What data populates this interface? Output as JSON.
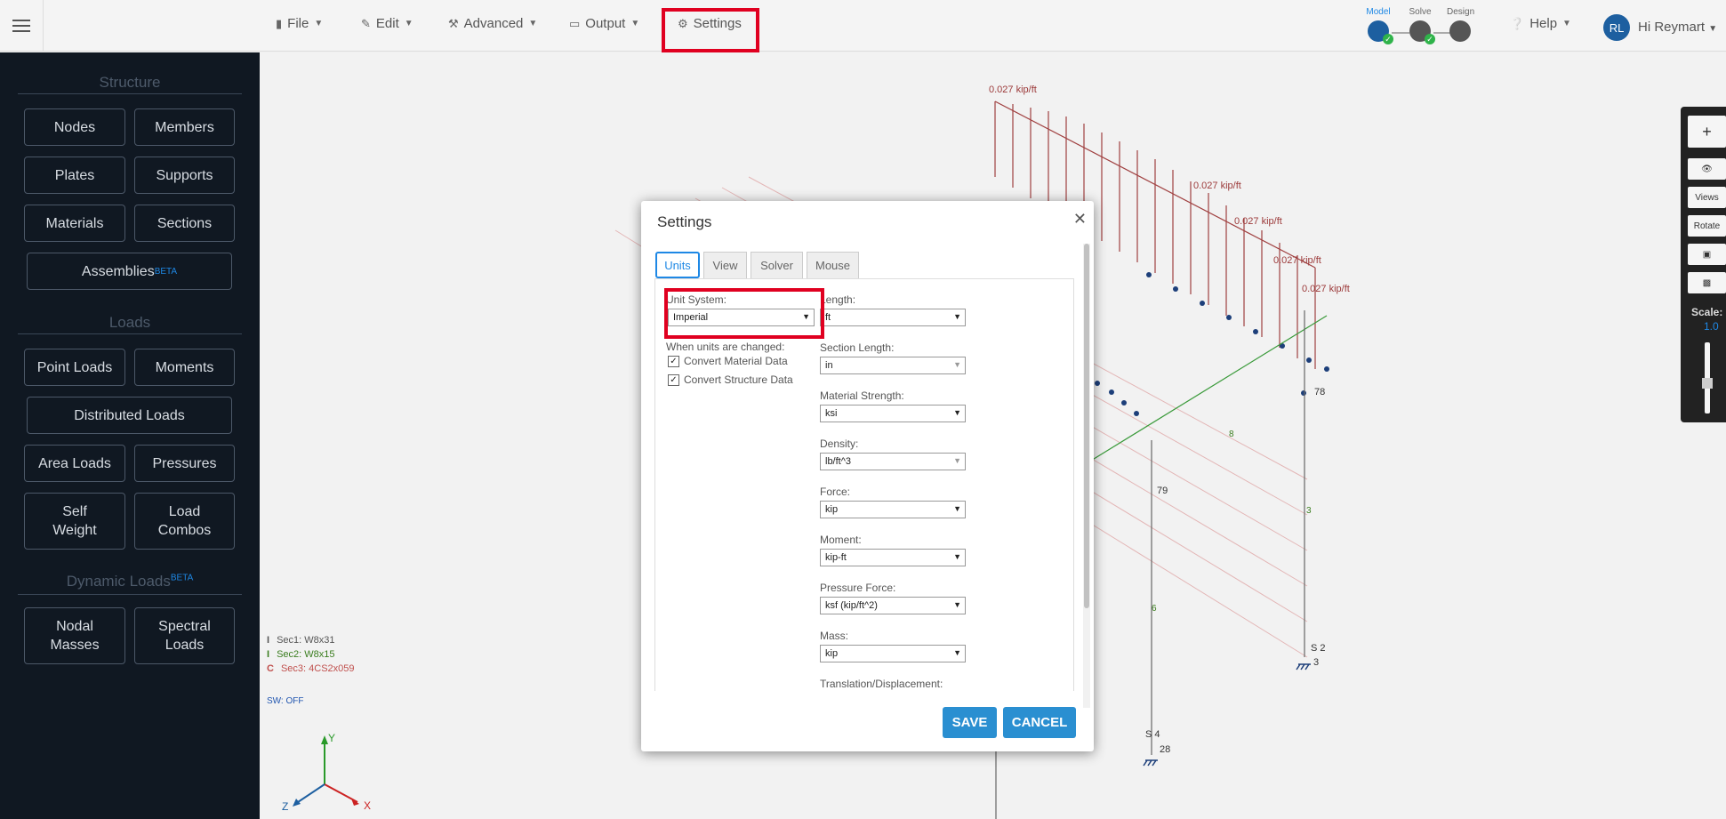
{
  "topbar": {
    "menus": [
      {
        "label": "File",
        "icon": "file-icon"
      },
      {
        "label": "Edit",
        "icon": "pencil-icon"
      },
      {
        "label": "Advanced",
        "icon": "wrench-icon"
      },
      {
        "label": "Output",
        "icon": "monitor-icon"
      },
      {
        "label": "Settings",
        "icon": "gear-icon"
      }
    ],
    "steps": [
      {
        "label": "Model"
      },
      {
        "label": "Solve"
      },
      {
        "label": "Design"
      }
    ],
    "help": "Help",
    "avatar_initials": "RL",
    "greeting": "Hi Reymart"
  },
  "sidebar": {
    "structure_title": "Structure",
    "loads_title": "Loads",
    "dynamic_title": "Dynamic Loads",
    "beta": "BETA",
    "buttons": {
      "nodes": "Nodes",
      "members": "Members",
      "plates": "Plates",
      "supports": "Supports",
      "materials": "Materials",
      "sections": "Sections",
      "assemblies": "Assemblies",
      "point_loads": "Point Loads",
      "moments": "Moments",
      "distributed_loads": "Distributed Loads",
      "area_loads": "Area Loads",
      "pressures": "Pressures",
      "self_weight_1": "Self",
      "self_weight_2": "Weight",
      "load_combos_1": "Load",
      "load_combos_2": "Combos",
      "nodal_masses_1": "Nodal",
      "nodal_masses_2": "Masses",
      "spectral_loads_1": "Spectral",
      "spectral_loads_2": "Loads"
    }
  },
  "canvas": {
    "legend": [
      {
        "sym": "I",
        "label": "Sec1: W8x31",
        "color": "#555555"
      },
      {
        "sym": "I",
        "label": "Sec2: W8x15",
        "color": "#3a7d1e"
      },
      {
        "sym": "C",
        "label": "Sec3: 4CS2x059",
        "color": "#c0504d"
      }
    ],
    "sw": "SW: OFF",
    "load_label": "0.027 kip/ft",
    "axes": {
      "x": "X",
      "y": "Y",
      "z": "Z"
    },
    "node_labels": [
      "78",
      "3",
      "28",
      "79",
      "S 2",
      "S 4"
    ],
    "member_labels": [
      "3",
      "6",
      "8"
    ],
    "right_toolbar": {
      "views": "Views",
      "rotate": "Rotate",
      "scale_label": "Scale:",
      "scale_value": "1.0"
    }
  },
  "modal": {
    "title": "Settings",
    "tabs": [
      "Units",
      "View",
      "Solver",
      "Mouse"
    ],
    "unit_system_label": "Unit System:",
    "unit_system_value": "Imperial",
    "when_changed": "When units are changed:",
    "convert_material": "Convert Material Data",
    "convert_structure": "Convert Structure Data",
    "fields": [
      {
        "label": "Length:",
        "value": "ft"
      },
      {
        "label": "Section Length:",
        "value": "in"
      },
      {
        "label": "Material Strength:",
        "value": "ksi"
      },
      {
        "label": "Density:",
        "value": "lb/ft^3"
      },
      {
        "label": "Force:",
        "value": "kip"
      },
      {
        "label": "Moment:",
        "value": "kip-ft"
      },
      {
        "label": "Pressure Force:",
        "value": "ksf (kip/ft^2)"
      },
      {
        "label": "Mass:",
        "value": "kip"
      },
      {
        "label": "Translation/Displacement:",
        "value": ""
      }
    ],
    "save": "SAVE",
    "cancel": "CANCEL"
  },
  "colors": {
    "accent": "#1e88e5",
    "highlight": "#e00020",
    "sidebar_bg": "#101822",
    "button_blue": "#2a8fd1"
  }
}
